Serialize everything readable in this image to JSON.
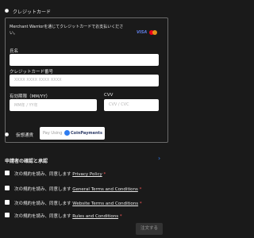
{
  "credit_card": {
    "label": "クレジットカード",
    "notice": "Merchant Warriorを通じてクレジットカードでお支払いください。",
    "brands": {
      "visa": "VISA",
      "mastercard": "mastercard"
    },
    "name_label": "氏名",
    "name_placeholder": "",
    "number_label": "クレジットカード番号",
    "number_placeholder": "XXXX XXXX XXXX XXXX",
    "expiry_label": "有効期限（MM/YY）",
    "expiry_placeholder": "MM年 / YY年",
    "cvv_label": "CVV",
    "cvv_placeholder": "CVV / CVC"
  },
  "crypto": {
    "label": "仮想通貨",
    "pay_using": "Pay Using",
    "provider": "CoinPayments"
  },
  "consent": {
    "title": "申請者の確認と承認",
    "prefix": "次の規約を読み、同意します",
    "items": [
      "Privacy Policy",
      "General Terms and Conditions",
      "Website Terms and Conditions",
      "Rules and Conditions"
    ],
    "required_mark": "*"
  },
  "order_button": "注文する",
  "colors": {
    "background": "#1a1a1a",
    "required": "#ff5757",
    "accent_blue": "#2f7df0"
  }
}
